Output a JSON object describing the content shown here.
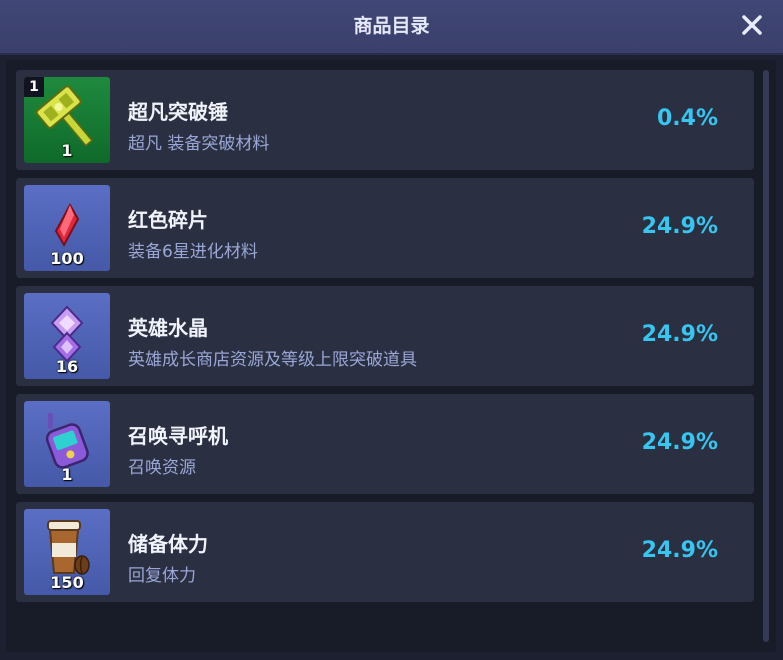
{
  "window": {
    "title": "商品目录",
    "close_icon": "close-icon"
  },
  "items": [
    {
      "name": "超凡突破锤",
      "desc": "超凡  装备突破材料",
      "qty": "1",
      "badge": "1",
      "probability": "0.4%",
      "icon": "hammer-icon",
      "bg": "#1f8a3e"
    },
    {
      "name": "红色碎片",
      "desc": "装备6星进化材料",
      "qty": "100",
      "probability": "24.9%",
      "icon": "red-crystal-icon",
      "bg": "#5a6fc4"
    },
    {
      "name": "英雄水晶",
      "desc": "英雄成长商店资源及等级上限突破道具",
      "qty": "16",
      "probability": "24.9%",
      "icon": "hero-crystal-icon",
      "bg": "#5a6fc4"
    },
    {
      "name": "召唤寻呼机",
      "desc": "召唤资源",
      "qty": "1",
      "probability": "24.9%",
      "icon": "pager-icon",
      "bg": "#5a6fc4"
    },
    {
      "name": "储备体力",
      "desc": "回复体力",
      "qty": "150",
      "probability": "24.9%",
      "icon": "coffee-cup-icon",
      "bg": "#5a6fc4"
    }
  ],
  "colors": {
    "accent": "#37c6f0",
    "header": "#3e4470",
    "row": "#2a2f42",
    "desc": "#9aa7d6"
  }
}
